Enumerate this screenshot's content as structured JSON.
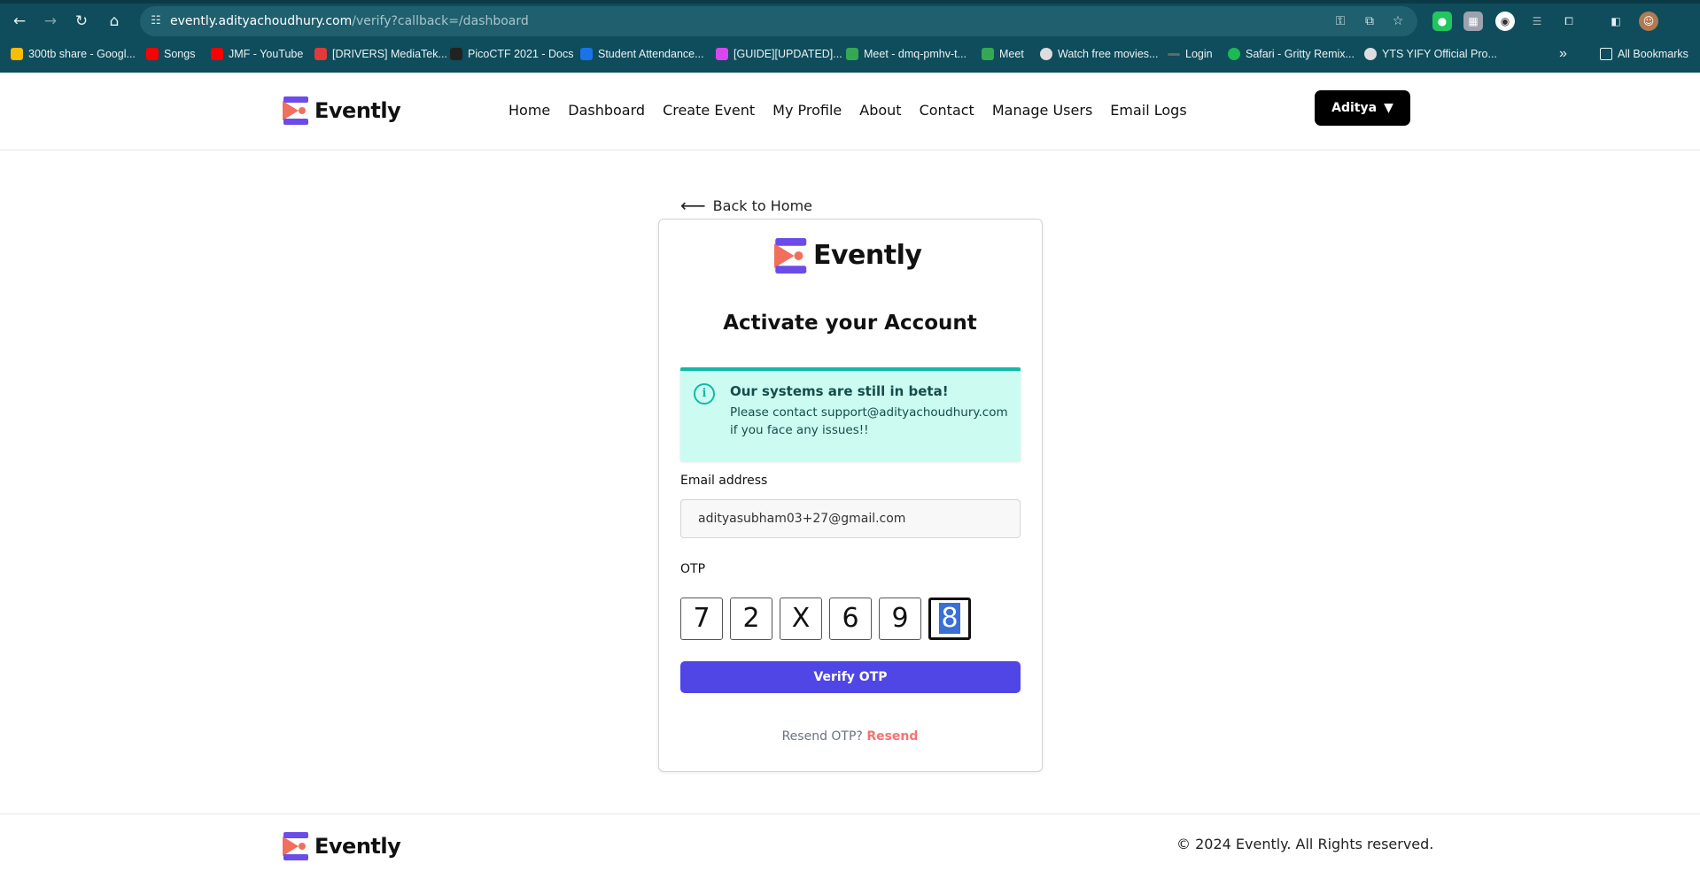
{
  "browser": {
    "url_host": "evently.adityachoudhury.com",
    "url_path": "/verify?callback=/dashboard",
    "bookmarks": [
      {
        "label": "300tb share - Googl...",
        "color": "#fbbc04"
      },
      {
        "label": "Songs",
        "color": "#ff0000"
      },
      {
        "label": "JMF - YouTube",
        "color": "#ff0000"
      },
      {
        "label": "[DRIVERS] MediaTek...",
        "color": "#e03a3a"
      },
      {
        "label": "PicoCTF 2021 - Docs",
        "color": "#222222"
      },
      {
        "label": "Student Attendance...",
        "color": "#1a73e8"
      },
      {
        "label": "[GUIDE][UPDATED]...",
        "color": "#d946ef"
      },
      {
        "label": "Meet - dmq-pmhv-t...",
        "color": "#34a853"
      },
      {
        "label": "Meet",
        "color": "#34a853"
      },
      {
        "label": "Watch free movies...",
        "color": "#dddddd"
      },
      {
        "label": "Login",
        "color": "#666666"
      },
      {
        "label": "Safari - Gritty Remix...",
        "color": "#1db954"
      },
      {
        "label": "YTS YIFY Official Pro...",
        "color": "#dddddd"
      }
    ],
    "more_bookmarks_icon": "»",
    "all_bookmarks_label": "All Bookmarks"
  },
  "header": {
    "brand": "Evently",
    "nav": [
      "Home",
      "Dashboard",
      "Create Event",
      "My Profile",
      "About",
      "Contact",
      "Manage Users",
      "Email Logs"
    ],
    "user_button": "Aditya",
    "user_caret": "▼"
  },
  "main": {
    "back_label": "Back to Home",
    "back_arrow": "⟵",
    "card_brand": "Evently",
    "title": "Activate your Account",
    "alert": {
      "title": "Our systems are still in beta!",
      "body": "Please contact support@adityachoudhury.com if you face any issues!!",
      "icon": "i"
    },
    "email_label": "Email address",
    "email_value": "adityasubham03+27@gmail.com",
    "otp_label": "OTP",
    "otp_digits": [
      "7",
      "2",
      "X",
      "6",
      "9",
      "8"
    ],
    "verify_label": "Verify OTP",
    "resend_prompt": "Resend OTP?",
    "resend_link": "Resend"
  },
  "footer": {
    "brand": "Evently",
    "copyright": "© 2024 Evently. All Rights reserved."
  },
  "colors": {
    "primary": "#4f46e5",
    "alert_bg": "#ccfbf1",
    "alert_border": "#14b8a6",
    "resend": "#f87171",
    "logo_purple": "#6c4ce8",
    "logo_coral": "#f26f5c"
  }
}
